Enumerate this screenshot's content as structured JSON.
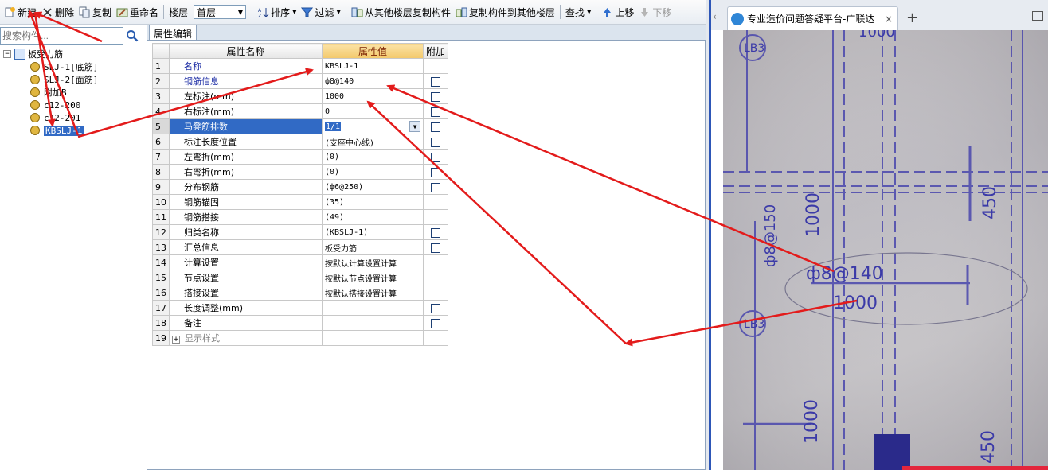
{
  "toolbar": {
    "new_label": "新建",
    "delete_label": "删除",
    "copy_label": "复制",
    "rename_label": "重命名",
    "floor_label": "楼层",
    "floor_value": "首层",
    "sort_label": "排序",
    "filter_label": "过滤",
    "copy_from_label": "从其他楼层复制构件",
    "copy_to_label": "复制构件到其他楼层",
    "find_label": "查找",
    "move_up_label": "上移",
    "move_down_label": "下移"
  },
  "left_panel": {
    "search_placeholder": "搜索构件...",
    "tree": {
      "root_label": "板受力筋",
      "items": [
        {
          "label": "SLJ-1[底筋]",
          "selected": false
        },
        {
          "label": "SLJ-2[面筋]",
          "selected": false
        },
        {
          "label": "附加B",
          "selected": false
        },
        {
          "label": "c12-200",
          "selected": false
        },
        {
          "label": "c12-201",
          "selected": false
        },
        {
          "label": "KBSLJ-1",
          "selected": true
        }
      ]
    }
  },
  "editor": {
    "tab_label": "属性编辑",
    "headers": {
      "name": "属性名称",
      "value": "属性值",
      "extra": "附加"
    },
    "rows": [
      {
        "num": "1",
        "name": "名称",
        "value": "KBSLJ-1",
        "check": false
      },
      {
        "num": "2",
        "name": "钢筋信息",
        "value": "ф8@140",
        "check": true
      },
      {
        "num": "3",
        "name": "左标注(mm)",
        "value": "1000",
        "check": true
      },
      {
        "num": "4",
        "name": "右标注(mm)",
        "value": "0",
        "check": true
      },
      {
        "num": "5",
        "name": "马凳筋排数",
        "value": "1/1",
        "check": true
      },
      {
        "num": "6",
        "name": "标注长度位置",
        "value": "(支座中心线)",
        "check": true
      },
      {
        "num": "7",
        "name": "左弯折(mm)",
        "value": "(0)",
        "check": true
      },
      {
        "num": "8",
        "name": "右弯折(mm)",
        "value": "(0)",
        "check": true
      },
      {
        "num": "9",
        "name": "分布钢筋",
        "value": "(ф6@250)",
        "check": true
      },
      {
        "num": "10",
        "name": "钢筋锚固",
        "value": "(35)",
        "check": false
      },
      {
        "num": "11",
        "name": "钢筋搭接",
        "value": "(49)",
        "check": false
      },
      {
        "num": "12",
        "name": "归类名称",
        "value": "(KBSLJ-1)",
        "check": true
      },
      {
        "num": "13",
        "name": "汇总信息",
        "value": "板受力筋",
        "check": true
      },
      {
        "num": "14",
        "name": "计算设置",
        "value": "按默认计算设置计算",
        "check": false
      },
      {
        "num": "15",
        "name": "节点设置",
        "value": "按默认节点设置计算",
        "check": false
      },
      {
        "num": "16",
        "name": "搭接设置",
        "value": "按默认搭接设置计算",
        "check": false
      },
      {
        "num": "17",
        "name": "长度调整(mm)",
        "value": "",
        "check": true
      },
      {
        "num": "18",
        "name": "备注",
        "value": "",
        "check": true
      },
      {
        "num": "19",
        "name": "显示样式",
        "value": "",
        "check": false
      }
    ]
  },
  "browser": {
    "tab_title": "专业造价问题答疑平台-广联达",
    "new_tab": "+",
    "close": "×"
  },
  "drawing_labels": {
    "lb3_top": "LB3",
    "lb3_mid": "LB3",
    "top_dim": "1000",
    "v1": "ф8@150",
    "v2": "1000",
    "v3": "450",
    "rebar": "ф8@140",
    "len": "1000",
    "v4": "1000",
    "v5": "450"
  },
  "colors": {
    "arrow": "#e31b1b",
    "selection": "#316ac5",
    "ink": "#3b3aa8"
  }
}
